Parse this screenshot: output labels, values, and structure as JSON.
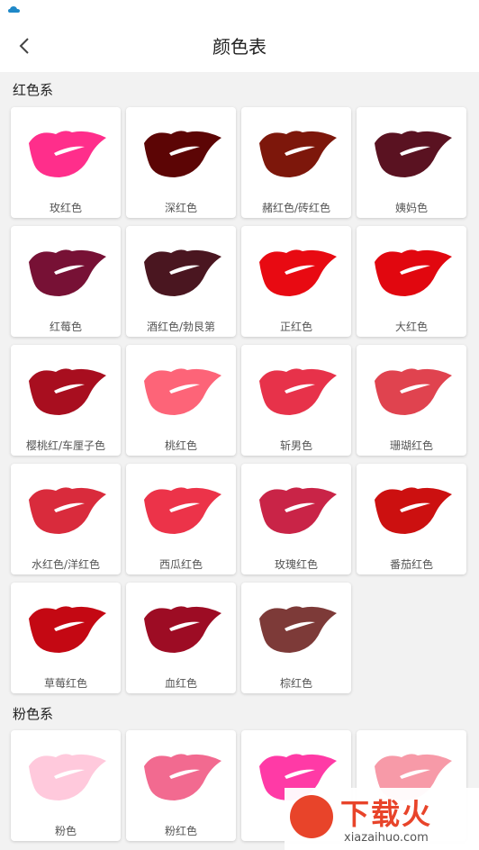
{
  "header": {
    "title": "颜色表"
  },
  "sections": [
    {
      "title": "红色系",
      "items": [
        {
          "label": "玫红色",
          "color": "#ff2e8b"
        },
        {
          "label": "深红色",
          "color": "#5c0505"
        },
        {
          "label": "赭红色/砖红色",
          "color": "#7d170b"
        },
        {
          "label": "姨妈色",
          "color": "#5a1221"
        },
        {
          "label": "红莓色",
          "color": "#771135"
        },
        {
          "label": "酒红色/勃艮第",
          "color": "#4a1620"
        },
        {
          "label": "正红色",
          "color": "#e80a12"
        },
        {
          "label": "大红色",
          "color": "#e1070f"
        },
        {
          "label": "樱桃红/车厘子色",
          "color": "#a80e1f"
        },
        {
          "label": "桃红色",
          "color": "#fd6478"
        },
        {
          "label": "斩男色",
          "color": "#e7324a"
        },
        {
          "label": "珊瑚红色",
          "color": "#e0434f"
        },
        {
          "label": "水红色/洋红色",
          "color": "#d92b3c"
        },
        {
          "label": "西瓜红色",
          "color": "#ec3349"
        },
        {
          "label": "玫瑰红色",
          "color": "#c92447"
        },
        {
          "label": "番茄红色",
          "color": "#cc1010"
        },
        {
          "label": "草莓红色",
          "color": "#c40813"
        },
        {
          "label": "血红色",
          "color": "#9d0c24"
        },
        {
          "label": "棕红色",
          "color": "#7d3a38"
        }
      ]
    },
    {
      "title": "粉色系",
      "items": [
        {
          "label": "粉色",
          "color": "#ffc9dc"
        },
        {
          "label": "粉红色",
          "color": "#f26a90"
        },
        {
          "label": "",
          "color": "#ff3aa6"
        },
        {
          "label": "",
          "color": "#f79aa8"
        }
      ]
    }
  ],
  "watermark": {
    "text": "下载火",
    "url": "xiazaihuo.com"
  }
}
